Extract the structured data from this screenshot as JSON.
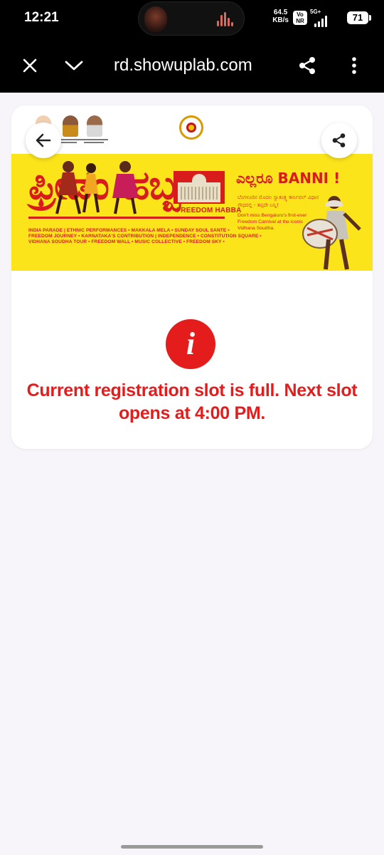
{
  "status_bar": {
    "time": "12:21",
    "net_speed_value": "64.5",
    "net_speed_unit": "KB/s",
    "volte_top": "Vo",
    "volte_bottom": "NR",
    "signal_label": "5G+",
    "battery": "71"
  },
  "browser": {
    "url": "rd.showuplab.com",
    "icons": {
      "close": "close-icon",
      "chevron": "chevron-down-icon",
      "share": "share-icon",
      "menu": "more-vert-icon"
    }
  },
  "page": {
    "header_icons": {
      "back": "arrow-left-icon",
      "share": "share-icon"
    },
    "banner": {
      "title_kannada": "ಫ್ರೀಡಂ ಹಬ್ಬ",
      "title_suffix": "ಬ",
      "freedom_habba": "FREEDOM HABBA",
      "ellaru_banni": "ಎಲ್ಲರೂ BANNI !",
      "tagline_kannada": "ಬೆಂಗಳೂರಿನ ಮೊದಲ ಸ್ವಾತಂತ್ರ್ಯ ಕಾರ್ನಿವಲ್ ವಿಧಾನ ಸೌಧದಲ್ಲಿ - ತಪ್ಪದೇ ಬನ್ನಿ!",
      "tagline_english": "Don't miss Bengaluru's first-ever Freedom Carnival at the iconic Vidhana Soudha.",
      "events": [
        "INDIA PARADE | ETHNIC PERFORMANCES ▪ MAKKALA MELA ▪ SUNDAY SOUL SANTE ▪",
        "FREEDOM JOURNEY ▪ KARNATAKA'S CONTRIBUTION | INDEPENDENCE ▪ CONSTITUTION SQUARE ▪",
        "VIDHANA SOUDHA TOUR ▪ FREEDOM WALL ▪ MUSIC COLLECTIVE ▪ FREEDOM SKY ▪"
      ]
    },
    "info": {
      "icon_glyph": "i",
      "message": "Current registration slot is full. Next slot opens at 4:00 PM."
    }
  },
  "colors": {
    "accent_red": "#e51c1c",
    "banner_yellow": "#fce41a",
    "banner_red": "#d81c1c",
    "page_background": "#f7f5fa"
  }
}
